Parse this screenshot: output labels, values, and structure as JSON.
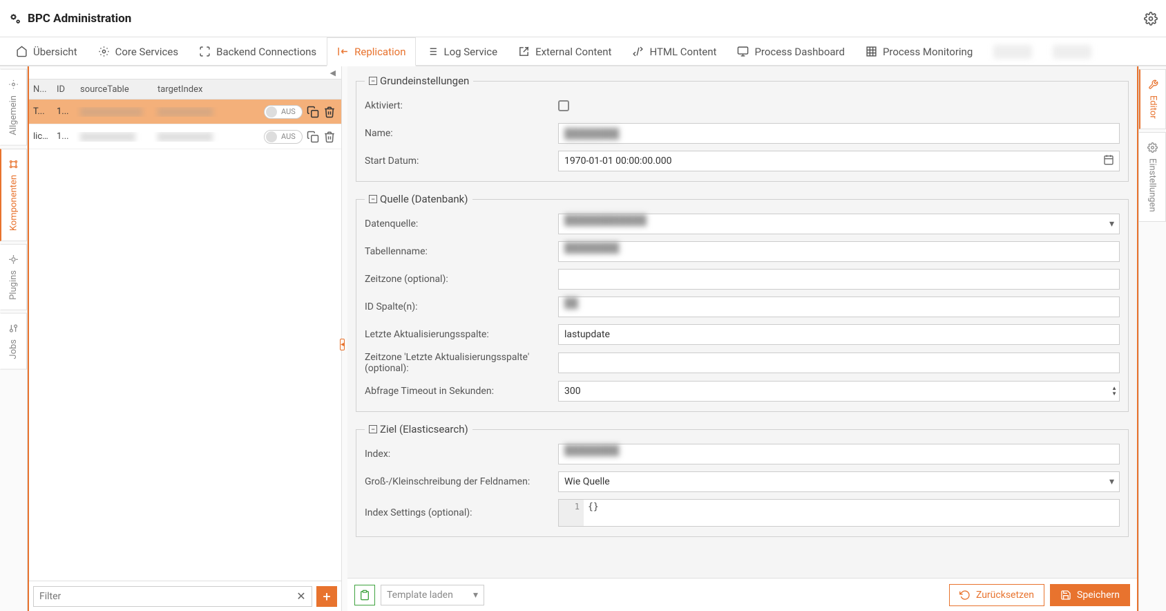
{
  "header": {
    "title": "BPC Administration"
  },
  "tabs": [
    {
      "label": "Übersicht"
    },
    {
      "label": "Core Services"
    },
    {
      "label": "Backend Connections"
    },
    {
      "label": "Replication"
    },
    {
      "label": "Log Service"
    },
    {
      "label": "External Content"
    },
    {
      "label": "HTML Content"
    },
    {
      "label": "Process Dashboard"
    },
    {
      "label": "Process Monitoring"
    }
  ],
  "vtabs_left": {
    "allgemein": "Allgemein",
    "komponenten": "Komponenten",
    "plugins": "Plugins",
    "jobs": "Jobs"
  },
  "vtabs_right": {
    "editor": "Editor",
    "einstellungen": "Einstellungen"
  },
  "table": {
    "head": {
      "name": "N...",
      "id": "ID",
      "source": "sourceTable",
      "target": "targetIndex"
    },
    "rows": [
      {
        "name": "T...",
        "id": "1...",
        "toggle": "AUS"
      },
      {
        "name": "lic...",
        "id": "1...",
        "toggle": "AUS"
      }
    ]
  },
  "filter": {
    "placeholder": "Filter"
  },
  "form": {
    "section1": {
      "legend": "Grundeinstellungen",
      "aktiviert_label": "Aktiviert:",
      "name_label": "Name:",
      "name_value": "",
      "start_label": "Start Datum:",
      "start_value": "1970-01-01 00:00:00.000"
    },
    "section2": {
      "legend": "Quelle (Datenbank)",
      "datenquelle_label": "Datenquelle:",
      "tabellenname_label": "Tabellenname:",
      "zeitzone_label": "Zeitzone (optional):",
      "idspalten_label": "ID Spalte(n):",
      "letzte_label": "Letzte Aktualisierungsspalte:",
      "letzte_value": "lastupdate",
      "zeitzone2_label": "Zeitzone 'Letzte Aktualisierungsspalte' (optional):",
      "timeout_label": "Abfrage Timeout in Sekunden:",
      "timeout_value": "300"
    },
    "section3": {
      "legend": "Ziel (Elasticsearch)",
      "index_label": "Index:",
      "case_label": "Groß-/Kleinschreibung der Feldnamen:",
      "case_value": "Wie Quelle",
      "settings_label": "Index Settings (optional):",
      "settings_line": "1",
      "settings_value": "{}"
    }
  },
  "footer": {
    "template_label": "Template laden",
    "reset": "Zurücksetzen",
    "save": "Speichern"
  }
}
